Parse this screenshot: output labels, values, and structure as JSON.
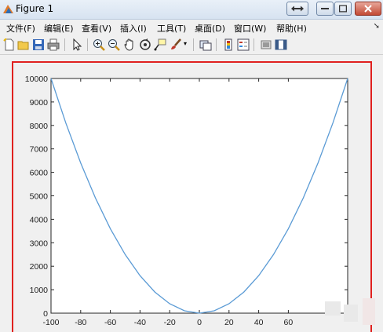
{
  "window": {
    "title": "Figure 1"
  },
  "menu": [
    "文件(F)",
    "编辑(E)",
    "查看(V)",
    "插入(I)",
    "工具(T)",
    "桌面(D)",
    "窗口(W)",
    "帮助(H)"
  ],
  "toolbar": {
    "icons": [
      "new-figure-icon",
      "open-file-icon",
      "save-icon",
      "print-icon",
      "select-arrow-icon",
      "zoom-in-icon",
      "zoom-out-icon",
      "pan-icon",
      "rotate-3d-icon",
      "data-cursor-icon",
      "brush-icon",
      "link-plot-icon",
      "colorbar-icon",
      "legend-icon",
      "hide-plot-tools-icon",
      "show-plot-tools-icon"
    ]
  },
  "chart_data": {
    "type": "line",
    "title": "",
    "xlabel": "",
    "ylabel": "",
    "xlim": [
      -100,
      100
    ],
    "ylim": [
      0,
      10000
    ],
    "x_ticks": [
      "-100",
      "-80",
      "-60",
      "-40",
      "-20",
      "0",
      "20",
      "40",
      "60"
    ],
    "y_ticks": [
      "0",
      "1000",
      "2000",
      "3000",
      "4000",
      "5000",
      "6000",
      "7000",
      "8000",
      "9000",
      "10000"
    ],
    "series": [
      {
        "color": "#5b9bd5",
        "x": [
          -100,
          -90,
          -80,
          -70,
          -60,
          -50,
          -40,
          -30,
          -20,
          -10,
          0,
          10,
          20,
          30,
          40,
          50,
          60,
          70,
          80,
          90,
          100
        ],
        "y": [
          10000,
          8100,
          6400,
          4900,
          3600,
          2500,
          1600,
          900,
          400,
          100,
          0,
          100,
          400,
          900,
          1600,
          2500,
          3600,
          4900,
          6400,
          8100,
          10000
        ]
      }
    ],
    "grid": false,
    "legend": "none"
  },
  "colors": {
    "highlight": "#e0201f",
    "line": "#5b9bd5"
  }
}
